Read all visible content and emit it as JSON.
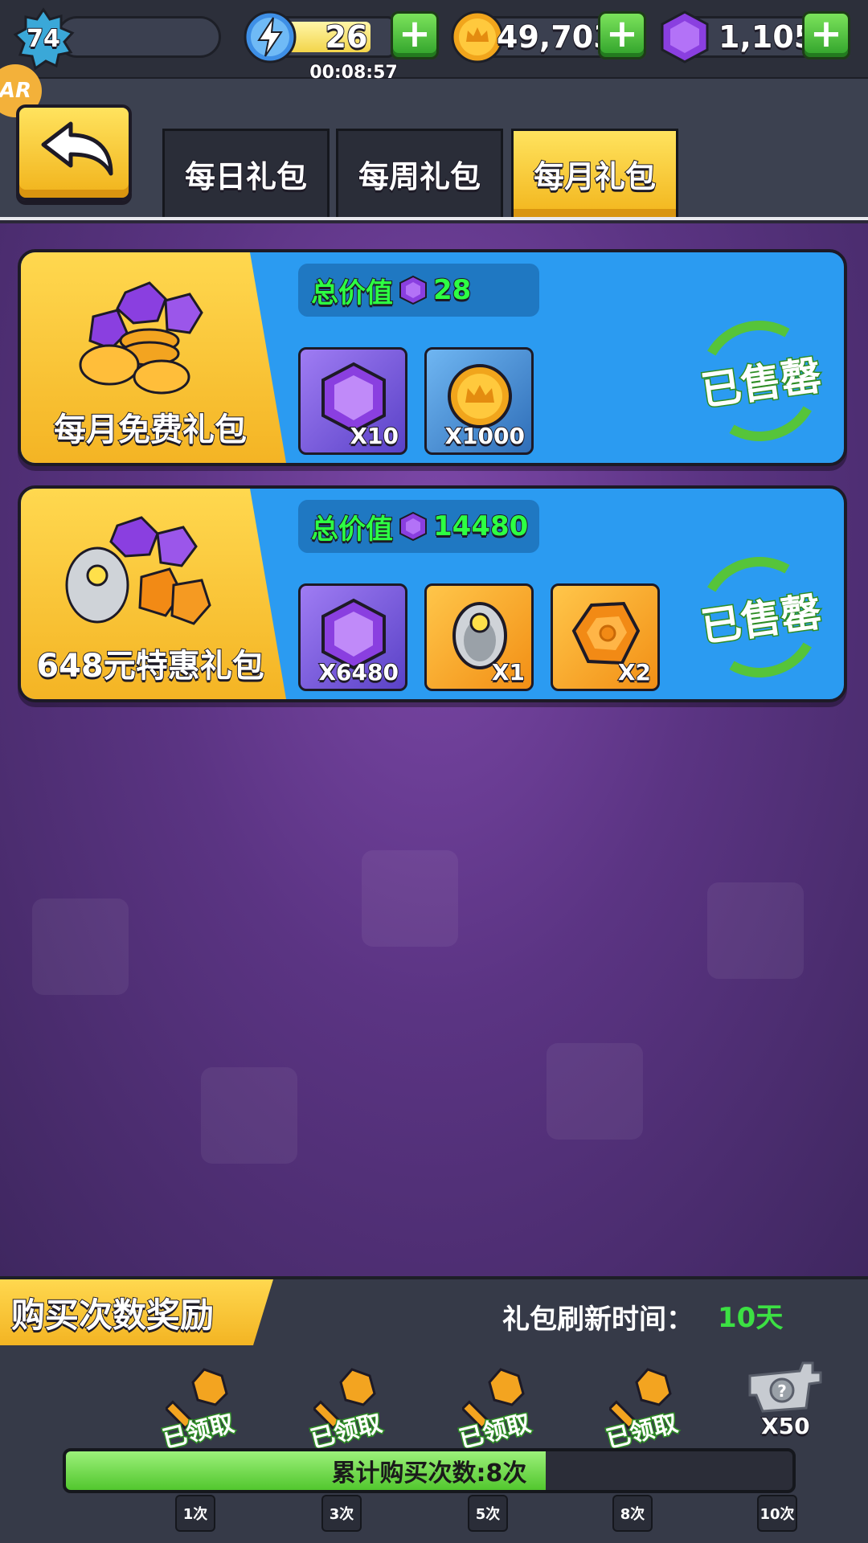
{
  "topbar": {
    "level": "74",
    "energy": "26",
    "energy_timer": "00:08:57",
    "coins": "49,703",
    "gems": "1,105",
    "plus_label": "+"
  },
  "header": {
    "ar_badge": "AR",
    "tabs": [
      {
        "label": "每日礼包",
        "active": false
      },
      {
        "label": "每周礼包",
        "active": false
      },
      {
        "label": "每月礼包",
        "active": true
      }
    ]
  },
  "packs": [
    {
      "name": "每月免费礼包",
      "total_label": "总价值",
      "total_value": "28",
      "items": [
        {
          "icon": "gem-icon",
          "qty": "X10"
        },
        {
          "icon": "coin-icon",
          "qty": "X1000"
        }
      ],
      "status": "已售罄"
    },
    {
      "name": "648元特惠礼包",
      "total_label": "总价值",
      "total_value": "14480",
      "items": [
        {
          "icon": "gem-icon",
          "qty": "X6480"
        },
        {
          "icon": "armor-icon",
          "qty": "X1"
        },
        {
          "icon": "ore-icon",
          "qty": "X2"
        }
      ],
      "status": "已售罄"
    }
  ],
  "rewards": {
    "title": "购买次数奖励",
    "refresh_label": "礼包刷新时间：",
    "refresh_value": "10天",
    "claimed_label": "已领取",
    "mystery_qty": "X50",
    "progress_text": "累计购买次数:8次",
    "progress_fraction": 0.66,
    "milestones": [
      "1次",
      "3次",
      "5次",
      "8次",
      "10次"
    ]
  },
  "colors": {
    "accent_yellow": "#f4b424",
    "card_blue": "#2b9bf1",
    "value_green": "#2dff43",
    "sold_green": "#56c43a"
  }
}
